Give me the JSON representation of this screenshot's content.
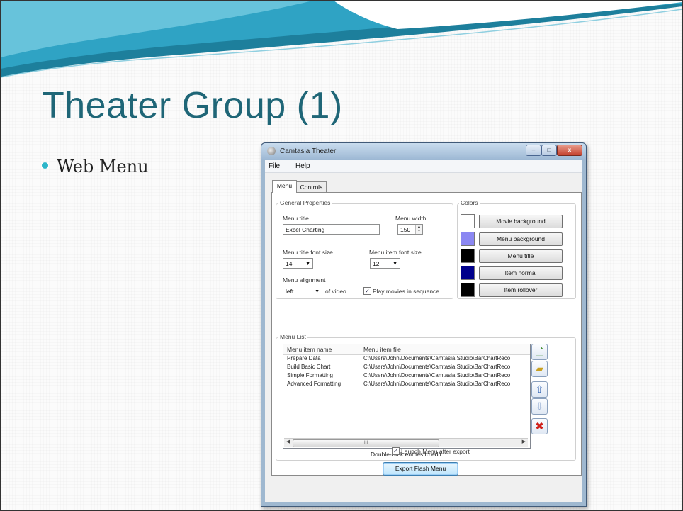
{
  "slide": {
    "title": "Theater Group (1)",
    "bullet": "Web Menu"
  },
  "window": {
    "title": "Camtasia Theater",
    "close_glyph": "x",
    "menubar": {
      "file": "File",
      "help": "Help"
    },
    "tabs": [
      {
        "label": "Menu",
        "selected": true
      },
      {
        "label": "Controls",
        "selected": false
      }
    ],
    "general": {
      "group_label": "General Properties",
      "menu_title_label": "Menu title",
      "menu_title_value": "Excel Charting",
      "menu_width_label": "Menu width",
      "menu_width_value": "150",
      "title_font_label": "Menu title font size",
      "title_font_value": "14",
      "item_font_label": "Menu item font size",
      "item_font_value": "12",
      "alignment_label": "Menu alignment",
      "alignment_value": "left",
      "of_video": "of video",
      "play_sequence_label": "Play movies in sequence",
      "play_sequence_checked": true
    },
    "colors": {
      "group_label": "Colors",
      "items": [
        {
          "label": "Movie background",
          "color": "#ffffff"
        },
        {
          "label": "Menu background",
          "color": "#8b87f2"
        },
        {
          "label": "Menu title",
          "color": "#000000"
        },
        {
          "label": "Item normal",
          "color": "#00008b"
        },
        {
          "label": "Item rollover",
          "color": "#000000"
        }
      ]
    },
    "menu_list": {
      "group_label": "Menu List",
      "columns": [
        "Menu item name",
        "Menu item file"
      ],
      "rows": [
        [
          "Prepare Data",
          "C:\\Users\\John\\Documents\\Camtasia Studio\\BarChartReco"
        ],
        [
          "Build Basic Chart",
          "C:\\Users\\John\\Documents\\Camtasia Studio\\BarChartReco"
        ],
        [
          "Simple Formatting",
          "C:\\Users\\John\\Documents\\Camtasia Studio\\BarChartReco"
        ],
        [
          "Advanced Formatting",
          "C:\\Users\\John\\Documents\\Camtasia Studio\\BarChartReco"
        ]
      ],
      "scroll_grip": "III",
      "hint": "Double-click entries to edit"
    },
    "launch_label": "Launch Menu after export",
    "launch_checked": true,
    "export_button": "Export Flash Menu"
  }
}
